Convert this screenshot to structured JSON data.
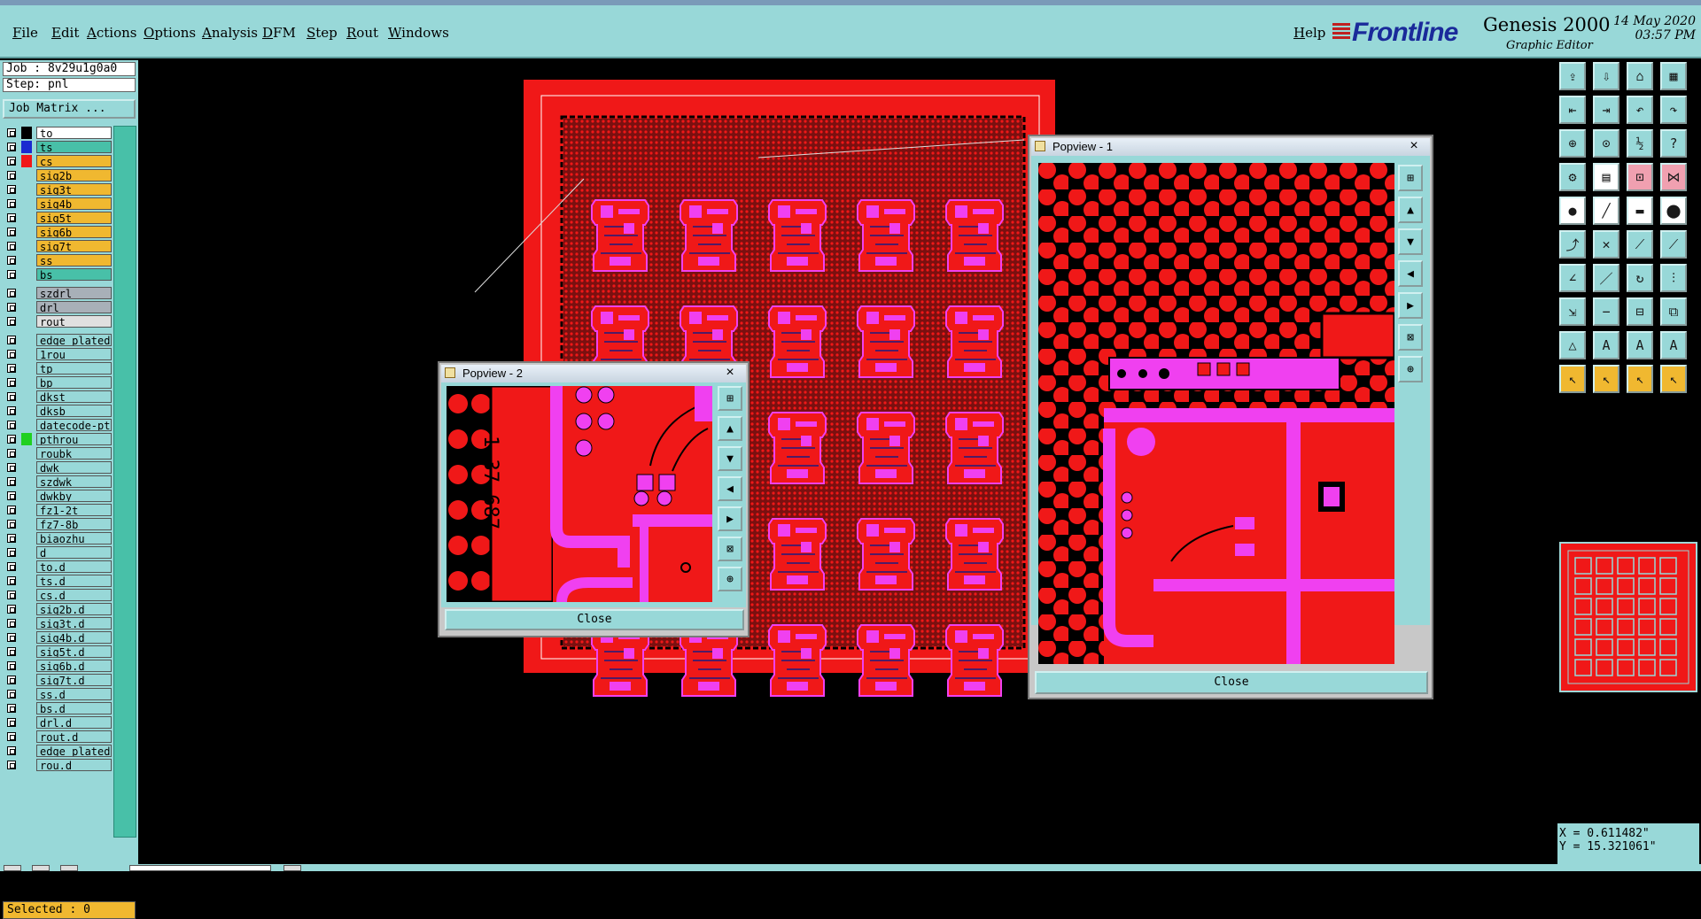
{
  "menu": {
    "items": [
      "File",
      "Edit",
      "Actions",
      "Options",
      "Analysis",
      "DFM",
      "Step",
      "Rout",
      "Windows"
    ],
    "help": "Help"
  },
  "brand": {
    "logo": "Frontline",
    "product": "Genesis 2000",
    "subtitle": "Graphic Editor",
    "date": "14 May 2020",
    "time": "03:57 PM"
  },
  "left": {
    "job": "Job : 8v29u1g0a0",
    "step": "Step: pnl",
    "job_matrix": "Job Matrix ...",
    "selected": "Selected : 0",
    "layers": [
      {
        "name": "to",
        "bg": "#ffffff",
        "swatch": "#000000"
      },
      {
        "name": "ts",
        "bg": "#48c0a8",
        "swatch": "#1a2ad0"
      },
      {
        "name": "cs",
        "bg": "#f0b830",
        "swatch": "#f01818"
      },
      {
        "name": "sig2b",
        "bg": "#f0b830",
        "swatch": ""
      },
      {
        "name": "sig3t",
        "bg": "#f0b830",
        "swatch": ""
      },
      {
        "name": "sig4b",
        "bg": "#f0b830",
        "swatch": ""
      },
      {
        "name": "sig5t",
        "bg": "#f0b830",
        "swatch": ""
      },
      {
        "name": "sig6b",
        "bg": "#f0b830",
        "swatch": ""
      },
      {
        "name": "sig7t",
        "bg": "#f0b830",
        "swatch": ""
      },
      {
        "name": "ss",
        "bg": "#f0b830",
        "swatch": ""
      },
      {
        "name": "bs",
        "bg": "#48c0a8",
        "swatch": ""
      },
      {
        "name": "szdrl",
        "bg": "#a8b0b8",
        "swatch": ""
      },
      {
        "name": "drl",
        "bg": "#a8b0b8",
        "swatch": ""
      },
      {
        "name": "rout",
        "bg": "#e0e0e0",
        "swatch": ""
      },
      {
        "name": "edge_plated",
        "bg": "#98d8d8",
        "swatch": ""
      },
      {
        "name": "1rou",
        "bg": "#98d8d8",
        "swatch": ""
      },
      {
        "name": "tp",
        "bg": "#98d8d8",
        "swatch": ""
      },
      {
        "name": "bp",
        "bg": "#98d8d8",
        "swatch": ""
      },
      {
        "name": "dkst",
        "bg": "#98d8d8",
        "swatch": ""
      },
      {
        "name": "dksb",
        "bg": "#98d8d8",
        "swatch": ""
      },
      {
        "name": "datecode-pto",
        "bg": "#98d8d8",
        "swatch": ""
      },
      {
        "name": "pthrou",
        "bg": "#98d8d8",
        "swatch": "#20d020"
      },
      {
        "name": "roubk",
        "bg": "#98d8d8",
        "swatch": ""
      },
      {
        "name": "dwk",
        "bg": "#98d8d8",
        "swatch": ""
      },
      {
        "name": "szdwk",
        "bg": "#98d8d8",
        "swatch": ""
      },
      {
        "name": "dwkby",
        "bg": "#98d8d8",
        "swatch": ""
      },
      {
        "name": "fz1-2t",
        "bg": "#98d8d8",
        "swatch": ""
      },
      {
        "name": "fz7-8b",
        "bg": "#98d8d8",
        "swatch": ""
      },
      {
        "name": "biaozhu",
        "bg": "#98d8d8",
        "swatch": ""
      },
      {
        "name": "d",
        "bg": "#98d8d8",
        "swatch": ""
      },
      {
        "name": "to.d",
        "bg": "#98d8d8",
        "swatch": ""
      },
      {
        "name": "ts.d",
        "bg": "#98d8d8",
        "swatch": ""
      },
      {
        "name": "cs.d",
        "bg": "#98d8d8",
        "swatch": ""
      },
      {
        "name": "sig2b.d",
        "bg": "#98d8d8",
        "swatch": ""
      },
      {
        "name": "sig3t.d",
        "bg": "#98d8d8",
        "swatch": ""
      },
      {
        "name": "sig4b.d",
        "bg": "#98d8d8",
        "swatch": ""
      },
      {
        "name": "sig5t.d",
        "bg": "#98d8d8",
        "swatch": ""
      },
      {
        "name": "sig6b.d",
        "bg": "#98d8d8",
        "swatch": ""
      },
      {
        "name": "sig7t.d",
        "bg": "#98d8d8",
        "swatch": ""
      },
      {
        "name": "ss.d",
        "bg": "#98d8d8",
        "swatch": ""
      },
      {
        "name": "bs.d",
        "bg": "#98d8d8",
        "swatch": ""
      },
      {
        "name": "drl.d",
        "bg": "#98d8d8",
        "swatch": ""
      },
      {
        "name": "rout.d",
        "bg": "#98d8d8",
        "swatch": ""
      },
      {
        "name": "edge_plated",
        "bg": "#98d8d8",
        "swatch": ""
      },
      {
        "name": "rou.d",
        "bg": "#98d8d8",
        "swatch": ""
      }
    ]
  },
  "popview1": {
    "title": "Popview - 1",
    "close_x": "×",
    "close": "Close"
  },
  "popview2": {
    "title": "Popview - 2",
    "close_x": "×",
    "close": "Close",
    "label": "1.37 687"
  },
  "coords": {
    "x": "X = 0.611482\"",
    "y": "Y = 15.321061\""
  },
  "colors": {
    "panel": "#98d8d8",
    "board": "#f01818",
    "pad": "#f040f0",
    "accent": "#f0b830"
  }
}
